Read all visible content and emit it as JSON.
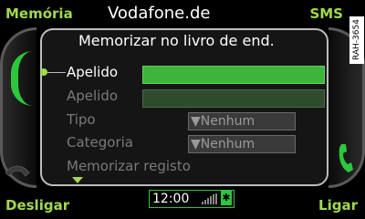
{
  "softkeys": {
    "top_left": "Memória",
    "top_right": "SMS",
    "bottom_left": "Desligar",
    "bottom_right": "Ligar"
  },
  "header": {
    "provider": "Vodafone.de"
  },
  "side_code": "RAH-3654",
  "dialog": {
    "title": "Memorizar no livro de end.",
    "rows": [
      {
        "label": "Apelido",
        "state": "active"
      },
      {
        "label": "Apelido",
        "state": "disabled"
      },
      {
        "label": "Tipo",
        "value": "▼Nenhum",
        "state": "disabled"
      },
      {
        "label": "Categoria",
        "value": "▼Nenhum",
        "state": "disabled"
      },
      {
        "label": "Memorizar registo",
        "state": "disabled"
      }
    ]
  },
  "status": {
    "time": "12:00",
    "bluetooth_glyph": "✱",
    "icons": [
      "signal-icon",
      "bluetooth-icon"
    ]
  },
  "colors": {
    "accent_green": "#9fd94e",
    "field_green": "#3db43b",
    "frame_green": "#2ec63d"
  }
}
